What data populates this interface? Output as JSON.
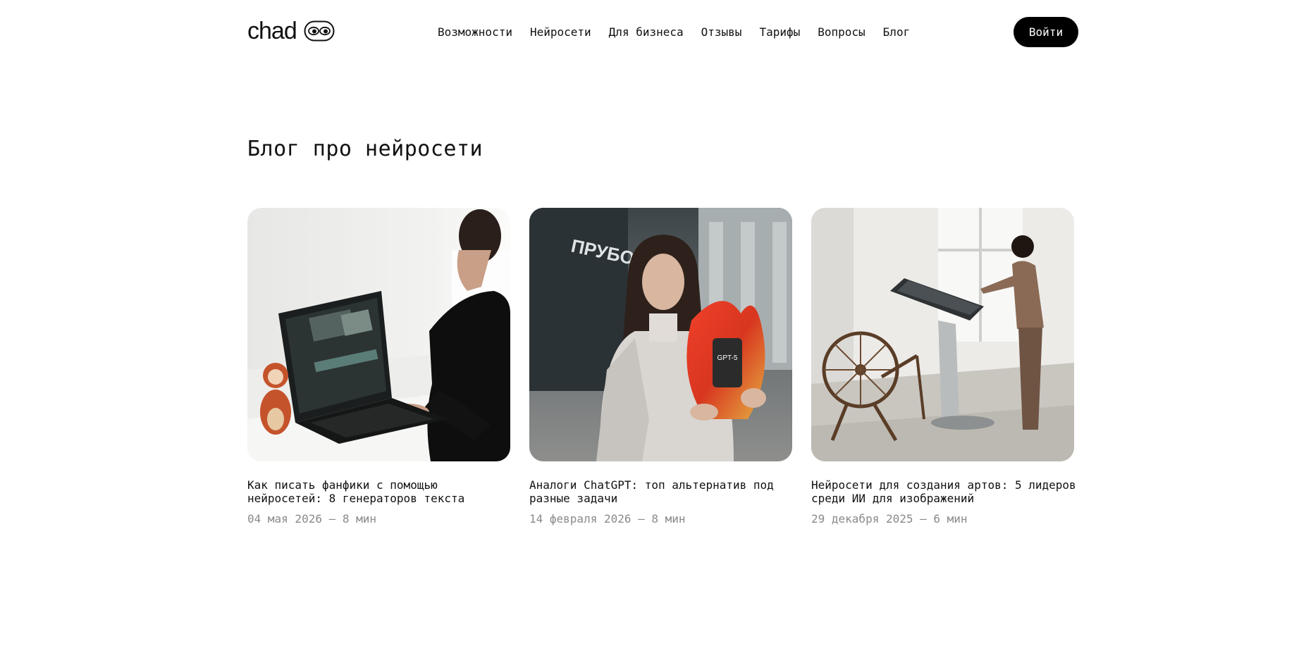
{
  "header": {
    "logo_text": "chad",
    "nav": [
      {
        "label": "Возможности"
      },
      {
        "label": "Нейросети"
      },
      {
        "label": "Для бизнеса"
      },
      {
        "label": "Отзывы"
      },
      {
        "label": "Тарифы"
      },
      {
        "label": "Вопросы"
      },
      {
        "label": "Блог"
      }
    ],
    "login_label": "Войти"
  },
  "main": {
    "title": "Блог про нейросети",
    "posts": [
      {
        "title": "Как писать фанфики с помощью нейросетей: 8 генераторов текста",
        "date": "04 мая 2026",
        "read_time": "8 мин",
        "meta": "04 мая 2026 — 8 мин"
      },
      {
        "title": "Аналоги ChatGPT: топ альтернатив под разные задачи",
        "date": "14 февраля 2026",
        "read_time": "8 мин",
        "meta": "14 февраля 2026 — 8 мин",
        "image_text": [
          "ПРУБОЛЬ",
          "GPT-5"
        ]
      },
      {
        "title": "Нейросети для создания артов: 5 лидеров среди ИИ для изображений",
        "date": "29 декабря 2025",
        "read_time": "6 мин",
        "meta": "29 декабря 2025 — 6 мин"
      }
    ]
  },
  "colors": {
    "background": "#ffffff",
    "text": "#111111",
    "muted": "#8a8a8a",
    "button": "#000000"
  },
  "icons": [
    "eyes-logo-icon"
  ]
}
